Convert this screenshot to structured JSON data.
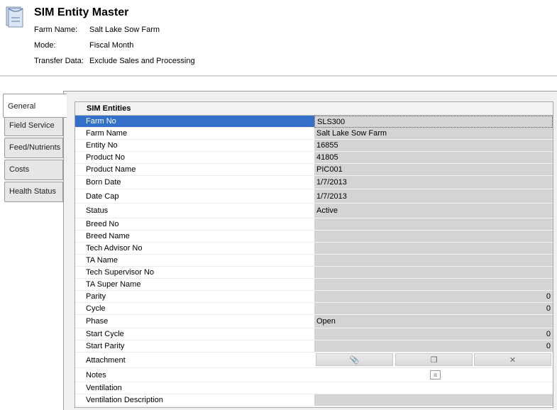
{
  "header": {
    "title": "SIM Entity Master",
    "icon": "document-stack-icon",
    "info": [
      {
        "label": "Farm Name:",
        "value": "Salt Lake Sow Farm"
      },
      {
        "label": "Mode:",
        "value": "Fiscal Month"
      },
      {
        "label": "Transfer Data:",
        "value": "Exclude Sales and Processing"
      }
    ]
  },
  "tabs": [
    {
      "label": "General",
      "active": true
    },
    {
      "label": "Field Service",
      "active": false
    },
    {
      "label": "Feed/Nutrients",
      "active": false
    },
    {
      "label": "Costs",
      "active": false
    },
    {
      "label": "Health Status",
      "active": false
    }
  ],
  "grid": {
    "title": "SIM Entities",
    "rows": [
      {
        "name": "Farm No",
        "value": "SLS300",
        "selected": true
      },
      {
        "name": "Farm Name",
        "value": "Salt Lake Sow Farm"
      },
      {
        "name": "Entity No",
        "value": "16855"
      },
      {
        "name": "Product No",
        "value": "41805"
      },
      {
        "name": "Product Name",
        "value": "PIC001"
      },
      {
        "name": "Born Date",
        "value": "1/7/2013"
      },
      {
        "name": "Date Cap",
        "value": "1/7/2013"
      },
      {
        "name": "Status",
        "value": "Active"
      },
      {
        "name": "Breed No",
        "value": ""
      },
      {
        "name": "Breed Name",
        "value": ""
      },
      {
        "name": "Tech Advisor No",
        "value": ""
      },
      {
        "name": "TA Name",
        "value": ""
      },
      {
        "name": "Tech Supervisor No",
        "value": ""
      },
      {
        "name": "TA Super Name",
        "value": ""
      },
      {
        "name": "Parity",
        "value": "0"
      },
      {
        "name": "Cycle",
        "value": "0"
      },
      {
        "name": "Phase",
        "value": "Open"
      },
      {
        "name": "Start Cycle",
        "value": "0"
      },
      {
        "name": "Start Parity",
        "value": "0"
      },
      {
        "name": "Attachment",
        "value": ""
      },
      {
        "name": "Notes",
        "value": ""
      },
      {
        "name": "Ventilation",
        "value": ""
      },
      {
        "name": "Ventilation Description",
        "value": ""
      }
    ],
    "attachment_buttons": [
      {
        "icon": "paperclip-icon",
        "glyph": "📎"
      },
      {
        "icon": "open-folder-icon",
        "glyph": "❐"
      },
      {
        "icon": "delete-x-icon",
        "glyph": "✕"
      }
    ],
    "notes_icon": {
      "icon": "note-icon",
      "glyph": "a"
    }
  },
  "colors": {
    "selection": "#3470c8",
    "value_bg": "#d4d4d4"
  }
}
